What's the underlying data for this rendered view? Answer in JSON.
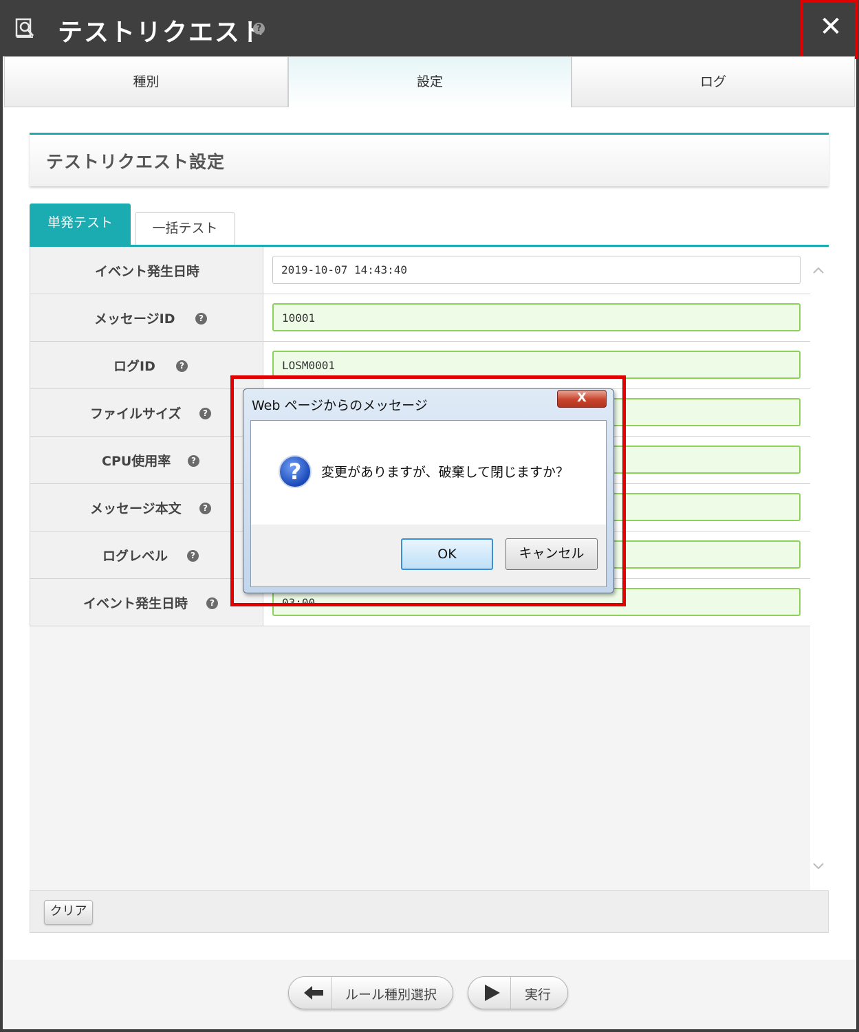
{
  "window": {
    "title": "テストリクエスト",
    "help_icon": "?",
    "close_icon": "✕"
  },
  "main_tabs": [
    {
      "label": "種別"
    },
    {
      "label": "設定"
    },
    {
      "label": "ログ"
    }
  ],
  "section": {
    "title": "テストリクエスト設定"
  },
  "sub_tabs": [
    {
      "label": "単発テスト"
    },
    {
      "label": "一括テスト"
    }
  ],
  "form": {
    "rows": [
      {
        "label": "イベント発生日時",
        "value": "2019-10-07 14:43:40"
      },
      {
        "label": "メッセージID",
        "value": "10001"
      },
      {
        "label": "ログID",
        "value": "LOSM0001"
      },
      {
        "label": "ファイルサイズ",
        "value": ""
      },
      {
        "label": "CPU使用率",
        "value": ""
      },
      {
        "label": "メッセージ本文",
        "value": ""
      },
      {
        "label": "ログレベル",
        "value": ""
      },
      {
        "label": "イベント発生日時",
        "value": "03:00"
      }
    ]
  },
  "footer": {
    "clear_label": "クリア"
  },
  "nav": {
    "back_label": "ルール種別選択",
    "run_label": "実行"
  },
  "dialog": {
    "title": "Web ページからのメッセージ",
    "close": "X",
    "icon": "?",
    "message": "変更がありますが、破棄して閉じますか？",
    "ok_label": "OK",
    "cancel_label": "キャンセル"
  },
  "colors": {
    "accent": "#1aacb1",
    "titlebar": "#3f3f3f",
    "highlight": "#e00000",
    "input_valid": "#8dd05a"
  }
}
